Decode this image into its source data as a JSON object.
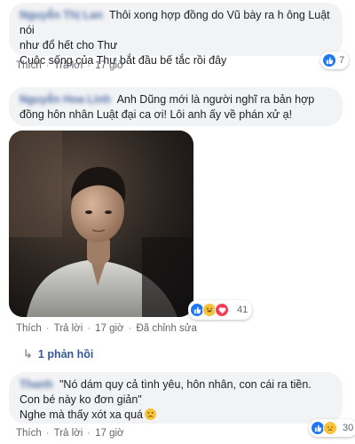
{
  "comments": [
    {
      "author": "Nguyễn Thị Lan",
      "lines": [
        "Thôi xong hợp đồng do Vũ bày ra h ông Luật nói",
        "như đổ hết cho Thư",
        "Cuộc sống của Thư bắt đầu bế tắc rồi đây"
      ],
      "like_label": "Thích",
      "reply_label": "Trả lời",
      "time": "17 giờ",
      "reaction_count": "7"
    },
    {
      "author": "Nguyễn Hoa Linh",
      "lines": [
        "Anh Dũng mới là người nghĩ ra bản hợp",
        "đồng hôn nhân Luật đại ca ơi! Lôi anh ấy về phán xử ạ!"
      ],
      "like_label": "Thích",
      "reply_label": "Trả lời",
      "time": "17 giờ",
      "edited_label": "Đã chỉnh sửa",
      "reaction_count": "41",
      "replies_label": "1 phản hồi"
    },
    {
      "author": "Thanh",
      "lines": [
        "\"Nó dám quy cả tình yêu, hôn nhân, con cái ra tiền.",
        "Con bé này ko đơn giản\"",
        "Nghe mà thấy xót xa quá"
      ],
      "like_label": "Thích",
      "reply_label": "Trả lời",
      "time": "17 giờ",
      "reaction_count": "30"
    }
  ],
  "icons": {
    "like": "like-icon",
    "haha": "haha-icon",
    "love": "love-icon",
    "sad": "sad-icon",
    "reply_arrow": "reply-arrow-icon"
  },
  "colors": {
    "link": "#385898",
    "bubble": "#f2f3f5",
    "meta": "#606770",
    "like": "#2078f4",
    "love": "#f33e58",
    "emoji": "#f7c33b"
  }
}
